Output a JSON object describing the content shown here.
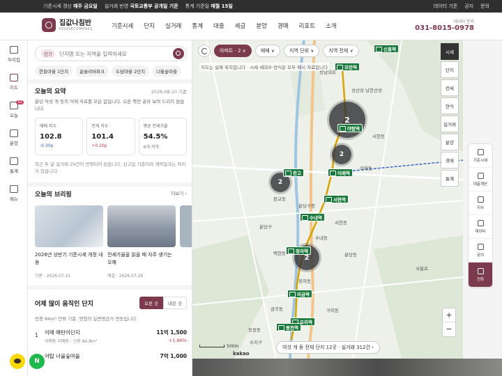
{
  "topbar": {
    "notices": [
      {
        "pre": "기준시세 갱신 ",
        "bold": "매주 금요일"
      },
      {
        "pre": "실거래 반영 ",
        "bold": "국토교통부 공개일 기준"
      },
      {
        "pre": "통계 기준일 ",
        "bold": "매월 15일"
      }
    ],
    "links": [
      "데이터 기준",
      "공지",
      "문의"
    ]
  },
  "header": {
    "logo_ko": "집값나침반",
    "logo_en": "HOUSECOMPASS",
    "nav": [
      "기준시세",
      "단지",
      "실거래",
      "통계",
      "대출",
      "세금",
      "분양",
      "경매",
      "리포트",
      "소개"
    ],
    "contact_label": "데이터 문의",
    "contact_tel": "031-8015-0978"
  },
  "rail": [
    {
      "label": "우리집",
      "icon": "home-icon"
    },
    {
      "label": "지도",
      "icon": "map-icon",
      "active": true
    },
    {
      "label": "오늘",
      "icon": "calendar-icon",
      "badge": "32"
    },
    {
      "label": "분양",
      "icon": "building-icon"
    },
    {
      "label": "통계",
      "icon": "chart-icon"
    },
    {
      "label": "메뉴",
      "icon": "menu-icon"
    }
  ],
  "search": {
    "tag": "인기",
    "placeholder": "단지명 또는 지역을 입력하세요",
    "chips": [
      "한들마을 1단지",
      "윤슬리버파크",
      "도담마을 2단지",
      "너울숲마을"
    ]
  },
  "summary": {
    "title": "오늘의 요약",
    "date": "2026.08.10 기준",
    "desc": "분당 여섯 개 동의 어제 자료를 모은 값입니다. 오른 쪽만 골라 보여 드리지 않습니다.",
    "cards": [
      {
        "label": "매매 지수",
        "value": "102.8",
        "delta": "-0.30p",
        "dir": "down"
      },
      {
        "label": "전세 지수",
        "value": "101.4",
        "delta": "+0.20p",
        "dir": "up"
      },
      {
        "label": "평균 전세가율",
        "value": "54.5%",
        "delta": "6개 지역",
        "dir": "neu"
      }
    ],
    "note": "최근 두 달 실거래 29건이 반영되어 있습니다. 신고일 기준이라 계약일과는 차이가 있습니다."
  },
  "briefing": {
    "title": "오늘의 브리핑",
    "more": "더보기 ›",
    "items": [
      {
        "title": "2026년 상반기 기준시세 개정 내용",
        "meta": "기준 · 2026.07.31"
      },
      {
        "title": "전세가율을 읽을 때 자주 생기는 오해",
        "meta": "해설 · 2026.07.24"
      },
      {
        "title": "",
        "meta": ""
      }
    ]
  },
  "active": {
    "title": "어제 많이 움직인 단지",
    "tab_on": "오른 곳",
    "tab_off": "내린 곳",
    "desc": "전용 84m² 안팎 기준. 평형의 일변평균가 변동입니다.",
    "items": [
      {
        "no": "1",
        "name": "이매 매탄이단지",
        "sub": "이매동 이매동 · 신용 84.8m²",
        "price": "11억 1,500",
        "change": "+1.86%"
      },
      {
        "no": "",
        "name": "야탑 너울숲마을",
        "sub": "",
        "price": "7억 1,000",
        "change": ""
      }
    ]
  },
  "map": {
    "filters": [
      "아파트 · 2 ∨",
      "매매 ∨",
      "지역 단위 ∨",
      "지역 전체 ∨"
    ],
    "note": "지도는 실제 위치입니다 · 시세 세대수·연식은 모두 예시 자료입니다",
    "total": "여섯 개 동 전체 단지 12곳 · 실거래 312건 ›",
    "scale": "500m",
    "brand": "kakao",
    "stations": [
      "신흥역",
      "모란역",
      "야탑역",
      "한고",
      "이매역",
      "서현역",
      "수내역",
      "정자역",
      "미금역",
      "오리역",
      "동천역"
    ],
    "clusters": [
      "2",
      "2",
      "2",
      "2"
    ],
    "dongs": [
      "성남대로",
      "성산성 남한산성",
      "이매동",
      "분당구청",
      "판교동",
      "분당구",
      "수내동",
      "정자동",
      "서현동",
      "분당동",
      "구미동",
      "수지구",
      "백현동",
      "금곡동",
      "동원동",
      "서울로",
      "서현동"
    ]
  },
  "map_tools": [
    "시세",
    "단지",
    "전세",
    "연식",
    "실거래",
    "분양",
    "경매",
    "통계"
  ],
  "right_tools": [
    "기준시세",
    "대출계산",
    "지수",
    "데이터",
    "문의",
    "전화"
  ],
  "colors": {
    "brand": "#7b3a4e",
    "station": "#1a7a3b",
    "down": "#3a62c9",
    "up": "#d2344a"
  }
}
